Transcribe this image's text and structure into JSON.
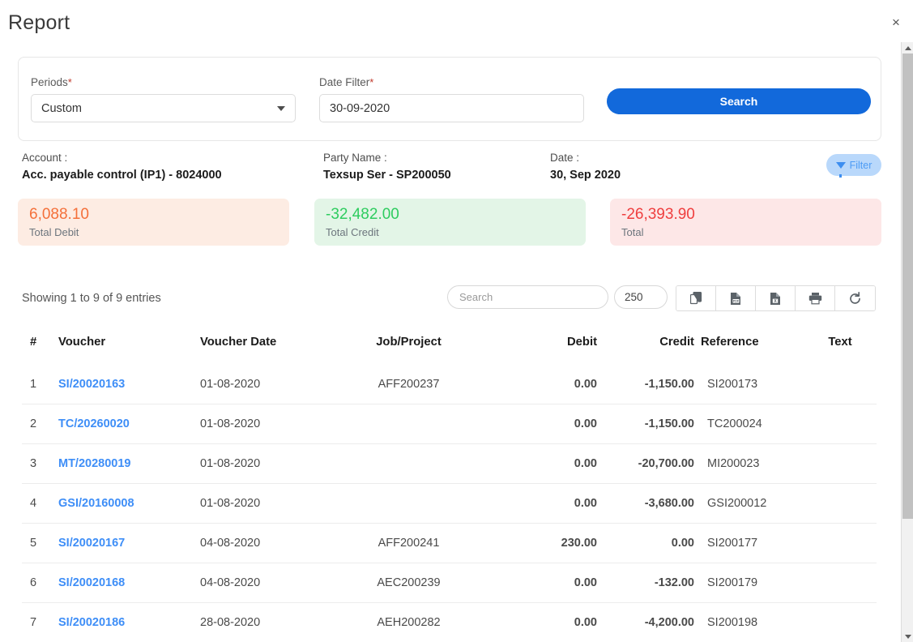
{
  "window": {
    "title": "Report",
    "close_label": "×"
  },
  "filters": {
    "periods": {
      "label": "Periods",
      "required": "*",
      "value": "Custom"
    },
    "date_filter": {
      "label": "Date Filter",
      "required": "*",
      "value": "30-09-2020",
      "placeholder": ""
    },
    "search_button": "Search"
  },
  "info": {
    "account_label": "Account :",
    "account_value": "Acc. payable control (IP1) - 8024000",
    "party_label": "Party Name :",
    "party_value": "Texsup Ser - SP200050",
    "date_label": "Date :",
    "date_value": "30, Sep 2020",
    "filter_button": "Filter"
  },
  "summary": {
    "debit": {
      "amount": "6,088.10",
      "label": "Total Debit",
      "color": "#f4703a",
      "bg": "#fdece3"
    },
    "credit": {
      "amount": "-32,482.00",
      "label": "Total Credit",
      "color": "#2ecc5f",
      "bg": "#e3f5e7"
    },
    "total": {
      "amount": "-26,393.90",
      "label": "Total",
      "color": "#ef3e3e",
      "bg": "#fde7e7"
    }
  },
  "table_controls": {
    "showing": "Showing 1 to 9 of 9 entries",
    "search_placeholder": "Search",
    "search_value": "",
    "page_length": "250",
    "buttons": [
      {
        "name": "copy-icon",
        "title": "Copy"
      },
      {
        "name": "pdf-file-icon",
        "title": "PDF"
      },
      {
        "name": "excel-file-icon",
        "title": "Excel"
      },
      {
        "name": "print-icon",
        "title": "Print"
      },
      {
        "name": "refresh-icon",
        "title": "Refresh"
      }
    ]
  },
  "table": {
    "columns": [
      "#",
      "Voucher",
      "Voucher Date",
      "Job/Project",
      "Debit",
      "Credit",
      "Reference",
      "Text"
    ],
    "rows": [
      {
        "num": "1",
        "voucher": "SI/20020163",
        "voucher_date": "01-08-2020",
        "job": "AFF200237",
        "debit": "0.00",
        "credit": "-1,150.00",
        "reference": "SI200173",
        "text": ""
      },
      {
        "num": "2",
        "voucher": "TC/20260020",
        "voucher_date": "01-08-2020",
        "job": "",
        "debit": "0.00",
        "credit": "-1,150.00",
        "reference": "TC200024",
        "text": ""
      },
      {
        "num": "3",
        "voucher": "MT/20280019",
        "voucher_date": "01-08-2020",
        "job": "",
        "debit": "0.00",
        "credit": "-20,700.00",
        "reference": "MI200023",
        "text": ""
      },
      {
        "num": "4",
        "voucher": "GSI/20160008",
        "voucher_date": "01-08-2020",
        "job": "",
        "debit": "0.00",
        "credit": "-3,680.00",
        "reference": "GSI200012",
        "text": ""
      },
      {
        "num": "5",
        "voucher": "SI/20020167",
        "voucher_date": "04-08-2020",
        "job": "AFF200241",
        "debit": "230.00",
        "credit": "0.00",
        "reference": "SI200177",
        "text": ""
      },
      {
        "num": "6",
        "voucher": "SI/20020168",
        "voucher_date": "04-08-2020",
        "job": "AEC200239",
        "debit": "0.00",
        "credit": "-132.00",
        "reference": "SI200179",
        "text": ""
      },
      {
        "num": "7",
        "voucher": "SI/20020186",
        "voucher_date": "28-08-2020",
        "job": "AEH200282",
        "debit": "0.00",
        "credit": "-4,200.00",
        "reference": "SI200198",
        "text": ""
      }
    ]
  },
  "theme": {
    "primary": "#1269DB",
    "link": "#3e8ef7",
    "filter_pill_bg": "#b9d8fb"
  }
}
